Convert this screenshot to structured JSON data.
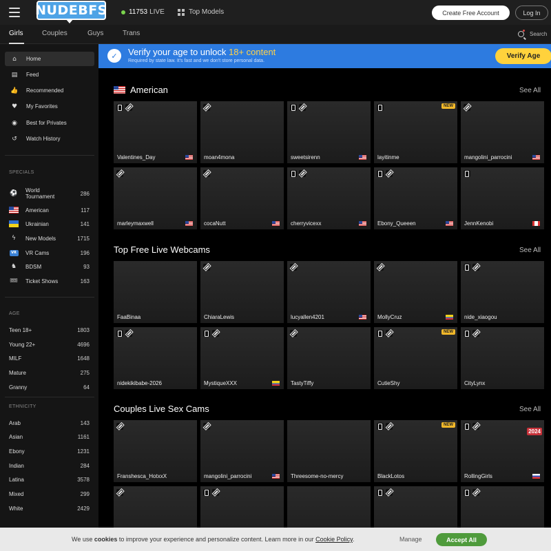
{
  "header": {
    "logo": "NUDEBFS",
    "live_count": "11753",
    "live_label": "LIVE",
    "top_models": "Top Models",
    "create_account": "Create Free Account",
    "login": "Log In"
  },
  "tabs": [
    "Girls",
    "Couples",
    "Guys",
    "Trans"
  ],
  "search_label": "Search",
  "sidebar": {
    "nav": [
      {
        "label": "Home",
        "icon": "home-icon"
      },
      {
        "label": "Feed",
        "icon": "feed-icon"
      },
      {
        "label": "Recommended",
        "icon": "thumbs-up-icon"
      },
      {
        "label": "My Favorites",
        "icon": "heart-icon"
      },
      {
        "label": "Best for Privates",
        "icon": "privates-icon"
      },
      {
        "label": "Watch History",
        "icon": "history-icon"
      }
    ],
    "specials_heading": "SPECIALS",
    "specials": [
      {
        "label": "World Tournament",
        "count": "286"
      },
      {
        "label": "American",
        "count": "117"
      },
      {
        "label": "Ukrainian",
        "count": "141"
      },
      {
        "label": "New Models",
        "count": "1715"
      },
      {
        "label": "VR Cams",
        "count": "196"
      },
      {
        "label": "BDSM",
        "count": "93"
      },
      {
        "label": "Ticket Shows",
        "count": "163"
      }
    ],
    "age_heading": "AGE",
    "age": [
      {
        "label": "Teen 18+",
        "count": "1803"
      },
      {
        "label": "Young 22+",
        "count": "4696"
      },
      {
        "label": "MILF",
        "count": "1648"
      },
      {
        "label": "Mature",
        "count": "275"
      },
      {
        "label": "Granny",
        "count": "64"
      }
    ],
    "ethnicity_heading": "ETHNICITY",
    "ethnicity": [
      {
        "label": "Arab",
        "count": "143"
      },
      {
        "label": "Asian",
        "count": "1161"
      },
      {
        "label": "Ebony",
        "count": "1231"
      },
      {
        "label": "Indian",
        "count": "284"
      },
      {
        "label": "Latina",
        "count": "3578"
      },
      {
        "label": "Mixed",
        "count": "299"
      },
      {
        "label": "White",
        "count": "2429"
      }
    ]
  },
  "banner": {
    "title_prefix": "Verify your age to unlock",
    "title_highlight": "18+ content",
    "subtitle": "Required by state law. It's fast and we don't store personal data.",
    "button": "Verify Age"
  },
  "sections": [
    {
      "title": "American",
      "see_all": "See All",
      "cards": [
        {
          "name": "Valentines_Day",
          "flag": "us",
          "icons": [
            "phone",
            "hd"
          ]
        },
        {
          "name": "moan4mona",
          "flag": "",
          "icons": [
            "hd"
          ]
        },
        {
          "name": "sweetsirenn",
          "flag": "us",
          "icons": [
            "phone",
            "hd"
          ]
        },
        {
          "name": "layitinme",
          "flag": "",
          "icons": [
            "phone"
          ],
          "badge": "NEW"
        },
        {
          "name": "mangolini_parrocini",
          "flag": "us",
          "icons": [
            "hd"
          ]
        },
        {
          "name": "marleymaxwell",
          "flag": "us",
          "icons": [
            "hd"
          ]
        },
        {
          "name": "cocaNutt",
          "flag": "us",
          "icons": [
            "hd"
          ]
        },
        {
          "name": "cherryvicexx",
          "flag": "us",
          "icons": [
            "phone",
            "hd"
          ]
        },
        {
          "name": "Ebony_Queeen",
          "flag": "us",
          "icons": [
            "phone",
            "hd"
          ]
        },
        {
          "name": "JennKenobi",
          "flag": "ca",
          "icons": [
            "phone"
          ]
        }
      ]
    },
    {
      "title": "Top Free Live Webcams",
      "see_all": "See All",
      "cards": [
        {
          "name": "FaaBinaa",
          "flag": "",
          "icons": []
        },
        {
          "name": "ChiaraLewis",
          "flag": "",
          "icons": [
            "hd"
          ]
        },
        {
          "name": "lucyallen4201",
          "flag": "us",
          "icons": [
            "hd"
          ]
        },
        {
          "name": "MollyCruz",
          "flag": "co",
          "icons": [
            "hd"
          ]
        },
        {
          "name": "nide_xiaogou",
          "flag": "",
          "icons": [
            "phone",
            "hd"
          ]
        },
        {
          "name": "nidekikibabe-2026",
          "flag": "",
          "icons": [
            "phone",
            "hd"
          ]
        },
        {
          "name": "MystiqueXXX",
          "flag": "co",
          "icons": [
            "phone",
            "hd"
          ]
        },
        {
          "name": "TastyTiffy",
          "flag": "",
          "icons": [
            "hd"
          ]
        },
        {
          "name": "CutieShy",
          "flag": "",
          "icons": [
            "phone",
            "hd"
          ],
          "badge": "NEW"
        },
        {
          "name": "CityLynx",
          "flag": "",
          "icons": [
            "phone",
            "hd"
          ]
        }
      ]
    },
    {
      "title": "Couples Live Sex Cams",
      "see_all": "See All",
      "cards": [
        {
          "name": "Franshesca_HotxxX",
          "flag": "",
          "icons": [
            "hd"
          ]
        },
        {
          "name": "mangolini_parrocini",
          "flag": "us",
          "icons": [
            "hd"
          ]
        },
        {
          "name": "Threesome-no-mercy",
          "flag": "",
          "icons": []
        },
        {
          "name": "BlackLotos",
          "flag": "",
          "icons": [
            "phone",
            "hd"
          ],
          "badge": "NEW"
        },
        {
          "name": "RollingGirls",
          "flag": "ru",
          "icons": [
            "phone",
            "hd"
          ],
          "badge2024": "2024"
        },
        {
          "name": "",
          "flag": "",
          "icons": [
            "hd"
          ]
        },
        {
          "name": "",
          "flag": "",
          "icons": [
            "phone",
            "hd"
          ]
        },
        {
          "name": "",
          "flag": "",
          "icons": []
        },
        {
          "name": "",
          "flag": "",
          "icons": [
            "phone",
            "hd"
          ]
        },
        {
          "name": "",
          "flag": "",
          "icons": [
            "phone",
            "hd"
          ]
        }
      ]
    }
  ],
  "cookie": {
    "prefix": "We use",
    "bold": "cookies",
    "text": "to improve your experience and personalize content. Learn more in our",
    "link": "Cookie Policy",
    "manage": "Manage",
    "accept": "Accept All"
  }
}
